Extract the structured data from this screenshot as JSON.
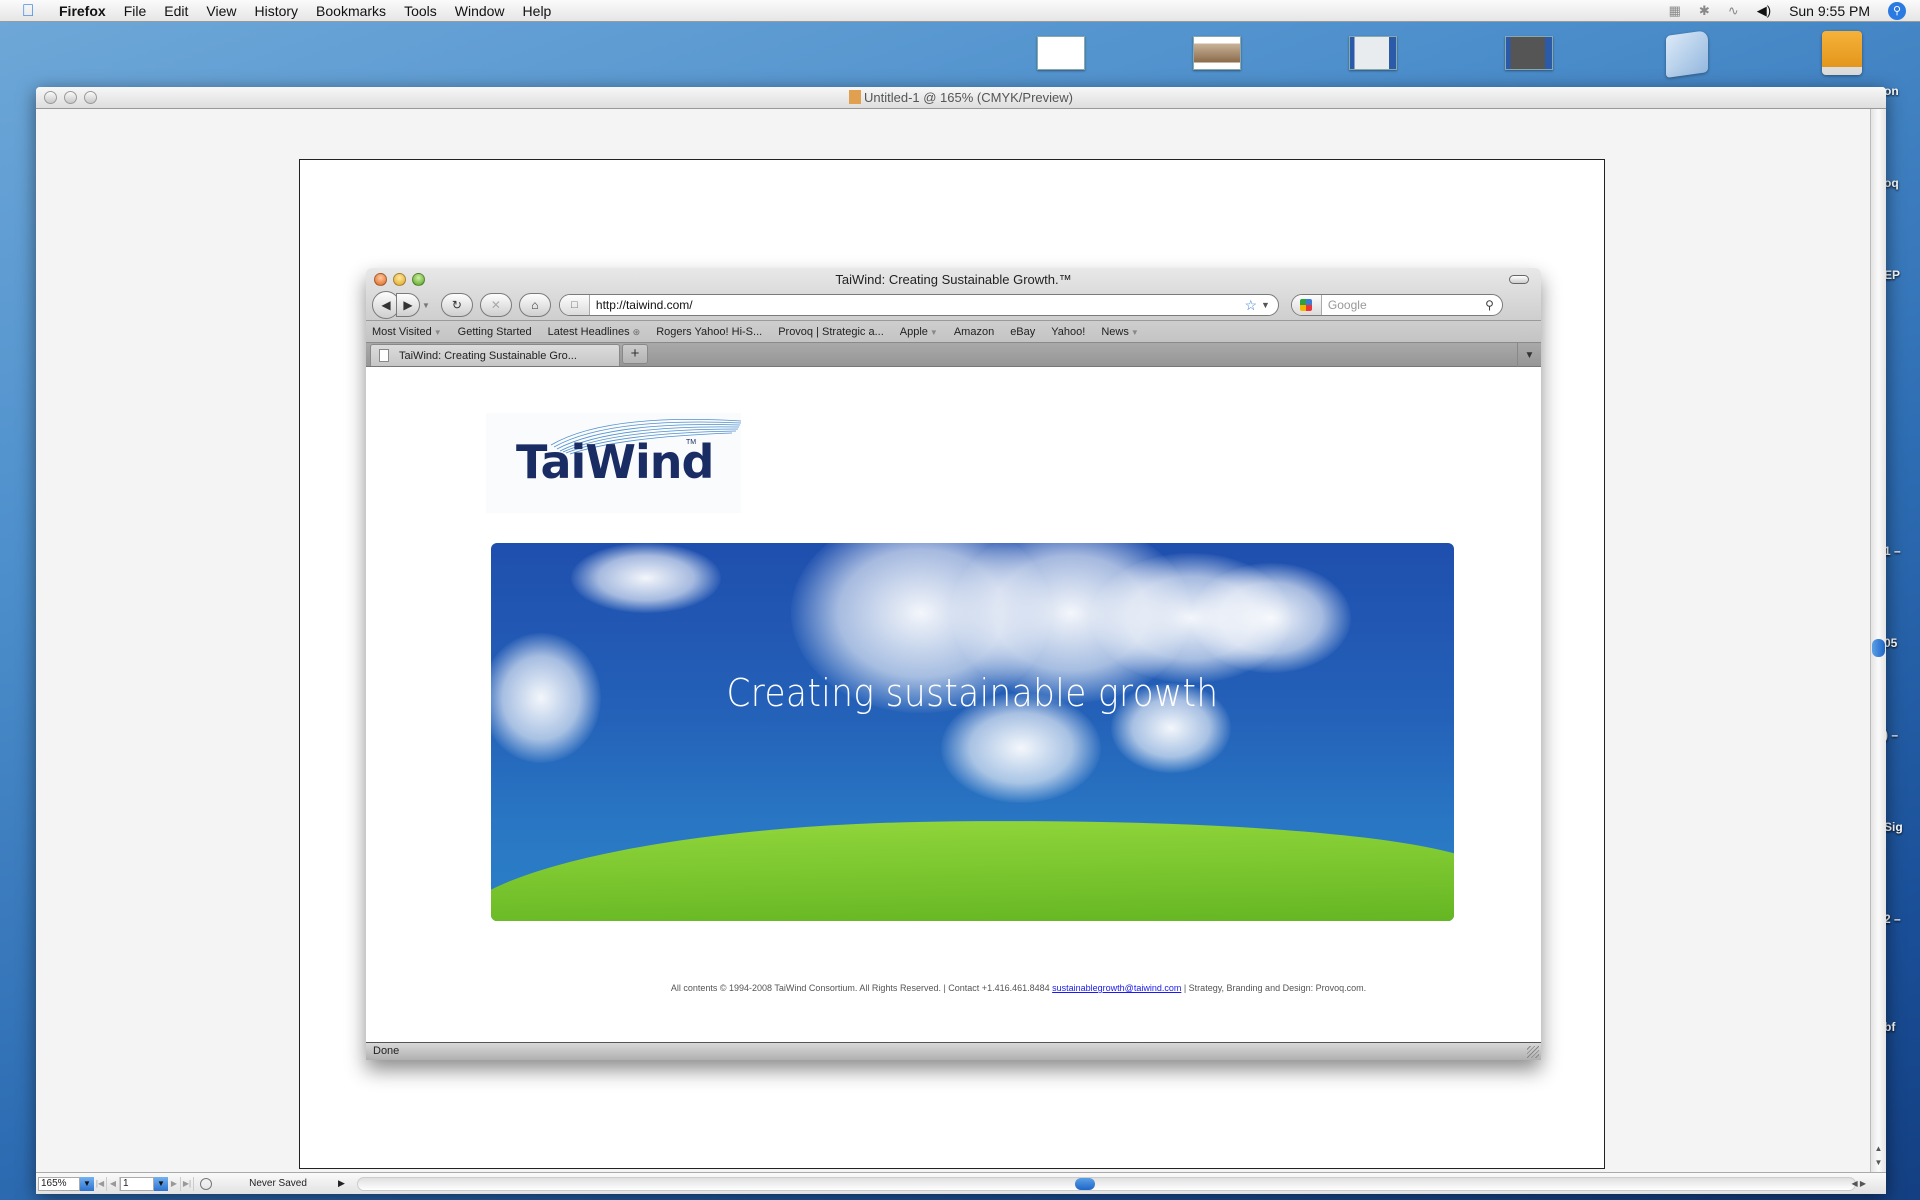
{
  "menubar": {
    "app_name": "Firefox",
    "menus": [
      "File",
      "Edit",
      "View",
      "History",
      "Bookmarks",
      "Tools",
      "Window",
      "Help"
    ],
    "clock": "Sun 9:55 PM"
  },
  "desktop": {
    "side_labels": [
      "on",
      "oq",
      "EP",
      "1 –",
      "05",
      ") –",
      "Sig",
      "2 –",
      "bf"
    ]
  },
  "doc_window": {
    "title": "Untitled-1 @ 165% (CMYK/Preview)",
    "zoom_level": "165%",
    "page_number": "1",
    "save_status": "Never Saved"
  },
  "browser": {
    "title": "TaiWind: Creating Sustainable Growth.™",
    "url": "http://taiwind.com/",
    "search_placeholder": "Google",
    "bookmarks": [
      {
        "label": "Most Visited",
        "dropdown": true
      },
      {
        "label": "Getting Started",
        "dropdown": false
      },
      {
        "label": "Latest Headlines",
        "dropdown": false,
        "rss": true
      },
      {
        "label": "Rogers Yahoo! Hi-S...",
        "dropdown": false
      },
      {
        "label": "Provoq | Strategic a...",
        "dropdown": false
      },
      {
        "label": "Apple",
        "dropdown": true
      },
      {
        "label": "Amazon",
        "dropdown": false
      },
      {
        "label": "eBay",
        "dropdown": false
      },
      {
        "label": "Yahoo!",
        "dropdown": false
      },
      {
        "label": "News",
        "dropdown": true
      }
    ],
    "tab_label": "TaiWind: Creating Sustainable Gro...",
    "new_tab_label": "+",
    "status": "Done"
  },
  "page": {
    "logo_text": "TaiWind",
    "logo_tm": "TM",
    "hero_text": "Creating sustainable growth",
    "footer_prefix": "All contents © 1994-2008 TaiWind Consortium. All Rights Reserved. | Contact +1.416.461.8484 ",
    "footer_email": "sustainablegrowth@taiwind.com",
    "footer_suffix": " | Strategy, Branding and Design: Provoq.com."
  }
}
